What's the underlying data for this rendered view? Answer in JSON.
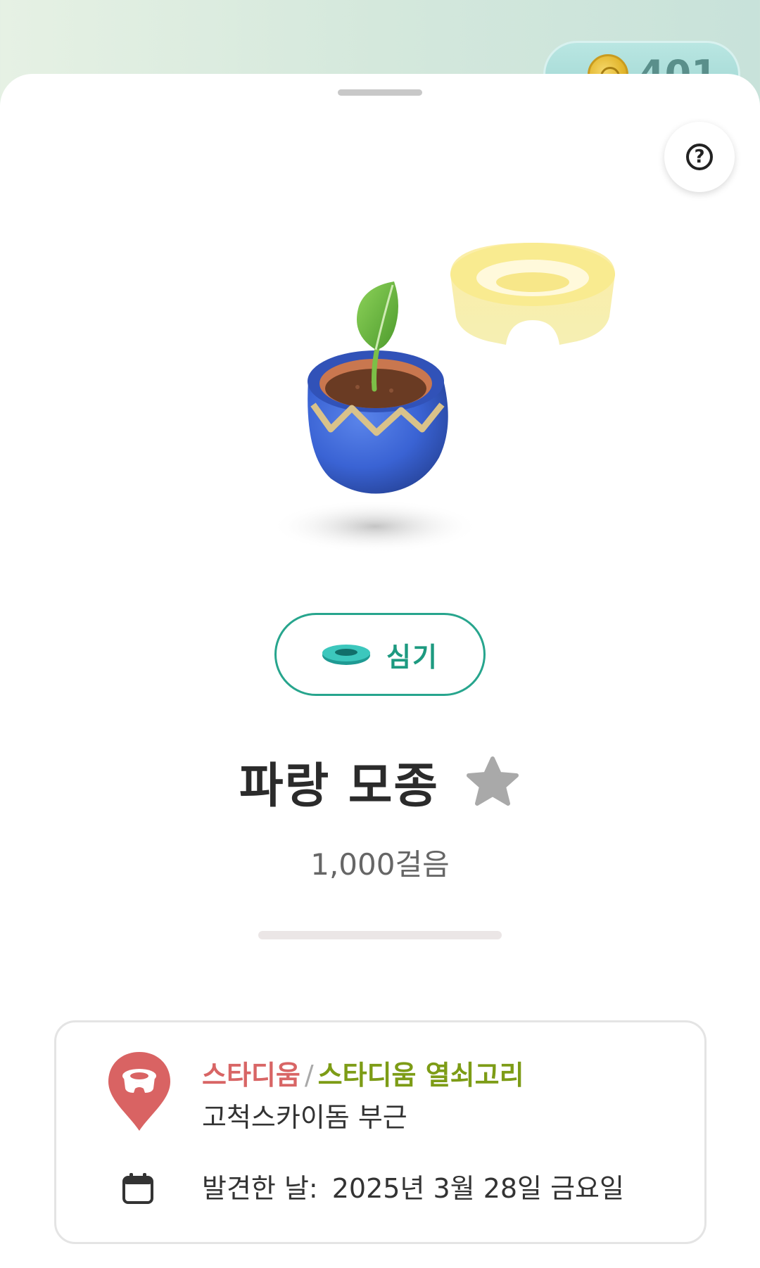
{
  "header": {
    "coin_count": "401",
    "coin_icon": "coin-icon"
  },
  "help": {
    "label": "?",
    "icon": "help-icon"
  },
  "plant_action": {
    "label": "심기",
    "icon": "pot-dish-icon"
  },
  "item": {
    "name": "파랑 모종",
    "steps": "1,000걸음",
    "progress_fraction": 0.0,
    "favorite_icon": "star-icon"
  },
  "location": {
    "category": "스타디움",
    "separator": "/",
    "subcategory": "스타디움 열쇠고리",
    "place": "고척스카이돔 부근",
    "pin_icon": "stadium-pin-icon"
  },
  "found": {
    "label": "발견한 날:",
    "date": "2025년 3월 28일 금요일",
    "icon": "calendar-icon"
  },
  "colors": {
    "accent": "#27a58d",
    "category": "#d86565",
    "subcategory": "#7d9c16",
    "pot_blue": "#3a63d4"
  }
}
